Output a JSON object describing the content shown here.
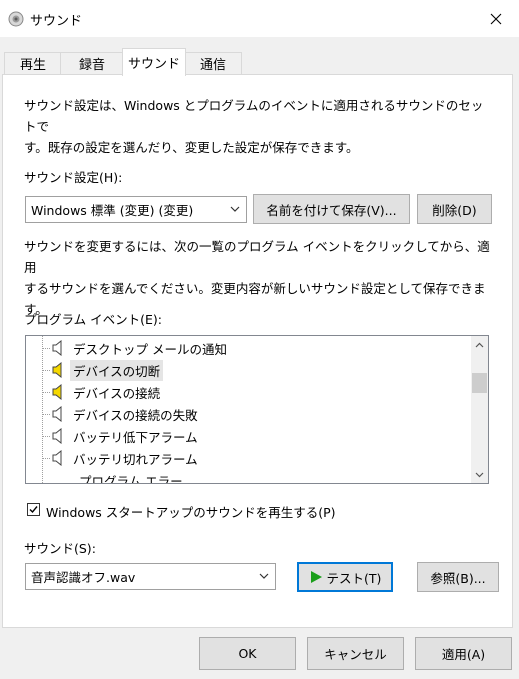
{
  "window": {
    "title": "サウンド",
    "icon": "speaker-app-icon",
    "close_icon": "close-icon"
  },
  "tabs": [
    {
      "label": "再生"
    },
    {
      "label": "録音"
    },
    {
      "label": "サウンド",
      "active": true
    },
    {
      "label": "通信"
    }
  ],
  "intro": {
    "line1": "サウンド設定は、Windows とプログラムのイベントに適用されるサウンドのセットで",
    "line2": "す。既存の設定を選んだり、変更した設定が保存できます。"
  },
  "scheme": {
    "label": "サウンド設定(H):",
    "selected": "Windows 標準 (変更) (変更)",
    "save_label": "名前を付けて保存(V)...",
    "delete_label": "削除(D)"
  },
  "instructions": {
    "line1": "サウンドを変更するには、次の一覧のプログラム イベントをクリックしてから、適用",
    "line2": "するサウンドを選んでください。変更内容が新しいサウンド設定として保存できま",
    "line3": "す。"
  },
  "events": {
    "label": "プログラム イベント(E):",
    "items": [
      {
        "label": "デスクトップ メールの通知",
        "has_sound": false
      },
      {
        "label": "デバイスの切断",
        "has_sound": true,
        "selected": true
      },
      {
        "label": "デバイスの接続",
        "has_sound": true
      },
      {
        "label": "デバイスの接続の失敗",
        "has_sound": false
      },
      {
        "label": "バッテリ低下アラーム",
        "has_sound": false
      },
      {
        "label": "バッテリ切れアラーム",
        "has_sound": false
      },
      {
        "label": "プログラム エラー",
        "has_sound": false
      }
    ]
  },
  "startup": {
    "label": "Windows スタートアップのサウンドを再生する(P)",
    "checked": true
  },
  "sound": {
    "label": "サウンド(S):",
    "selected": "音声認識オフ.wav",
    "test_label": "テスト(T)",
    "browse_label": "参照(B)..."
  },
  "footer": {
    "ok_label": "OK",
    "cancel_label": "キャンセル",
    "apply_label": "適用(A)"
  },
  "colors": {
    "accent": "#0078d7",
    "play_green": "#1a9e1a",
    "speaker_yellow": "#f5d800"
  }
}
